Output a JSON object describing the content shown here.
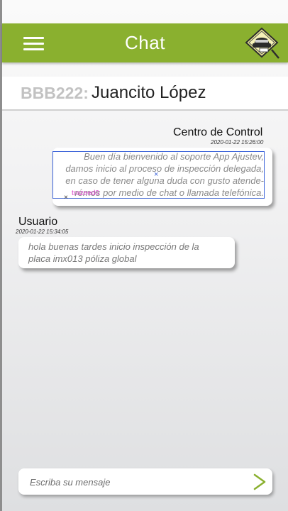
{
  "header": {
    "title": "Chat",
    "menu_icon": "hamburger-menu-icon",
    "logo_icon": "insurance-car-logo-icon"
  },
  "case": {
    "plate": "BBB222:",
    "client_name": "Juancito López"
  },
  "messages": [
    {
      "sender": "Centro de Control",
      "timestamp": "2020-01-22 15:26:00",
      "lines": [
        "Buen día bienvenido al soporte App Ajustev,",
        "damos inicio al proceso de inspección delegada,",
        "en caso de tener alguna duda con gusto atende-",
        "rémos por medio de chat o llamada telefónica."
      ]
    },
    {
      "sender": "Usuario",
      "timestamp": "2020-01-22 15:34:05",
      "lines": [
        "hola buenas tardes inicio inspección de la",
        "placa imx013 póliza global"
      ]
    }
  ],
  "annotation": {
    "label": "trazeed0",
    "marker": "×"
  },
  "composer": {
    "placeholder": "Escriba su mensaje",
    "send_icon": "send-chevron-icon"
  },
  "colors": {
    "topbar": "#8ab02f",
    "plate_text": "#c2c2c2",
    "bubble_text": "#8a8a8a",
    "annotation_box": "#3c63d9",
    "annotation_label": "#d63ec9",
    "send_icon": "#8ab02f"
  }
}
